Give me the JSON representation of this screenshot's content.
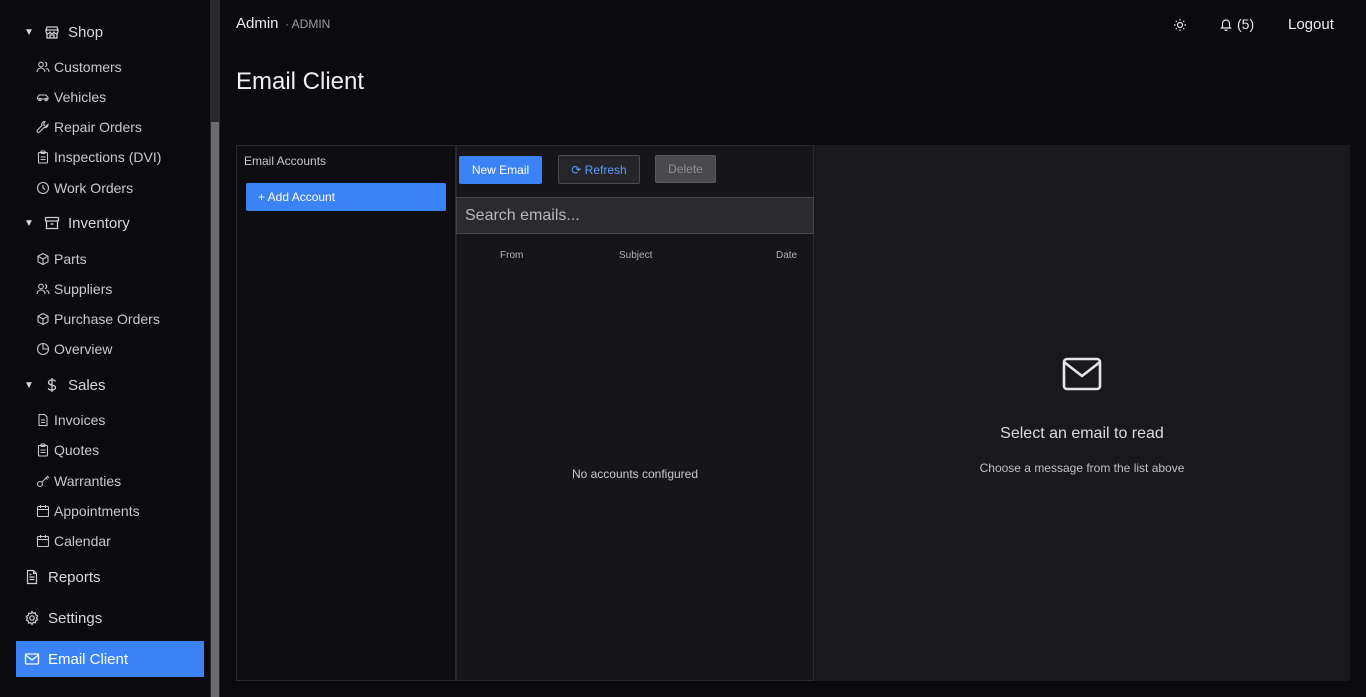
{
  "sidebar": {
    "groups": [
      {
        "label": "Shop",
        "icon": "store-icon",
        "items": [
          {
            "label": "Customers",
            "icon": "users-icon"
          },
          {
            "label": "Vehicles",
            "icon": "car-icon"
          },
          {
            "label": "Repair Orders",
            "icon": "wrench-icon"
          },
          {
            "label": "Inspections (DVI)",
            "icon": "clipboard-icon"
          },
          {
            "label": "Work Orders",
            "icon": "clock-icon"
          }
        ]
      },
      {
        "label": "Inventory",
        "icon": "archive-icon",
        "items": [
          {
            "label": "Parts",
            "icon": "package-icon"
          },
          {
            "label": "Suppliers",
            "icon": "users-icon"
          },
          {
            "label": "Purchase Orders",
            "icon": "package-icon"
          },
          {
            "label": "Overview",
            "icon": "pie-chart-icon"
          }
        ]
      },
      {
        "label": "Sales",
        "icon": "dollar-icon",
        "items": [
          {
            "label": "Invoices",
            "icon": "file-icon"
          },
          {
            "label": "Quotes",
            "icon": "clipboard-icon"
          },
          {
            "label": "Warranties",
            "icon": "key-icon"
          },
          {
            "label": "Appointments",
            "icon": "calendar-icon"
          },
          {
            "label": "Calendar",
            "icon": "calendar-icon"
          }
        ]
      }
    ],
    "reports": "Reports",
    "settings": "Settings",
    "email_client": "Email Client"
  },
  "header": {
    "user": "Admin",
    "role": "· ADMIN",
    "notifications": "(5)",
    "logout": "Logout"
  },
  "page_title": "Email Client",
  "accounts": {
    "title": "Email Accounts",
    "add_button": "+ Add Account"
  },
  "toolbar": {
    "new_email": "New Email",
    "refresh": "⟳ Refresh",
    "delete": "Delete"
  },
  "search": {
    "placeholder": "Search emails..."
  },
  "columns": {
    "from": "From",
    "subject": "Subject",
    "date": "Date"
  },
  "list_empty": "No accounts configured",
  "reader": {
    "title": "Select an email to read",
    "subtitle": "Choose a message from the list above"
  },
  "colors": {
    "accent": "#3b82f6",
    "background": "#0b0b0d"
  }
}
